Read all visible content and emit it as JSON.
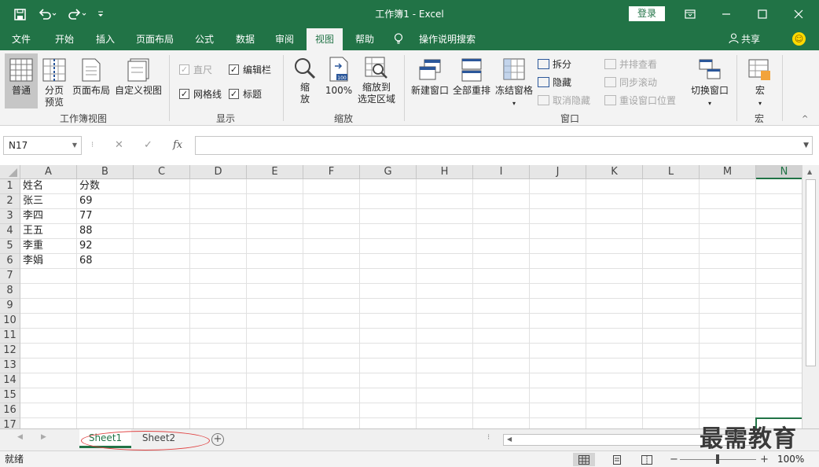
{
  "window": {
    "title": "工作簿1  -  Excel",
    "login_label": "登录",
    "qa_icons": [
      "save-icon",
      "undo-icon",
      "redo-icon",
      "customize-icon"
    ],
    "win_icons": [
      "ribbon-display-icon",
      "minimize-icon",
      "maximize-icon",
      "close-icon"
    ]
  },
  "tabs": [
    "文件",
    "开始",
    "插入",
    "页面布局",
    "公式",
    "数据",
    "审阅",
    "视图",
    "帮助"
  ],
  "active_tab": "视图",
  "tell_me": "操作说明搜索",
  "share_label": "共享",
  "ribbon": {
    "workbook_views": {
      "label": "工作簿视图",
      "normal": "普通",
      "page_break_1": "分页",
      "page_break_2": "预览",
      "page_layout": "页面布局",
      "custom": "自定义视图"
    },
    "show": {
      "label": "显示",
      "ruler": "直尺",
      "formula_bar": "编辑栏",
      "gridlines": "网格线",
      "headings": "标题"
    },
    "zoom": {
      "label": "缩放",
      "zoom_1": "缩",
      "zoom_2": "放",
      "hundred": "100%",
      "to_sel_1": "缩放到",
      "to_sel_2": "选定区域"
    },
    "window": {
      "label": "窗口",
      "new_window": "新建窗口",
      "arrange_all": "全部重排",
      "freeze": "冻结窗格",
      "split": "拆分",
      "hide": "隐藏",
      "unhide": "取消隐藏",
      "side_by_side": "并排查看",
      "sync_scroll": "同步滚动",
      "reset_pos": "重设窗口位置",
      "switch": "切换窗口"
    },
    "macros": {
      "label": "宏",
      "macro": "宏"
    }
  },
  "formula_bar": {
    "name_box": "N17",
    "fx": "fx",
    "formula": ""
  },
  "grid": {
    "columns": [
      "A",
      "B",
      "C",
      "D",
      "E",
      "F",
      "G",
      "H",
      "I",
      "J",
      "K",
      "L",
      "M",
      "N"
    ],
    "rows": [
      "1",
      "2",
      "3",
      "4",
      "5",
      "6",
      "7",
      "8",
      "9",
      "10",
      "11",
      "12",
      "13",
      "14",
      "15",
      "16",
      "17"
    ],
    "cells": [
      [
        "姓名",
        "分数"
      ],
      [
        "张三",
        "69"
      ],
      [
        "李四",
        "77"
      ],
      [
        "王五",
        "88"
      ],
      [
        "李重",
        "92"
      ],
      [
        "李娟",
        "68"
      ]
    ],
    "selected_cell": "N17",
    "selected_col": "N"
  },
  "sheets": [
    "Sheet1",
    "Sheet2"
  ],
  "active_sheet": "Sheet1",
  "status": {
    "ready": "就绪",
    "zoom": "100%",
    "minus": "−",
    "plus": "+"
  },
  "watermark": "最需教育"
}
